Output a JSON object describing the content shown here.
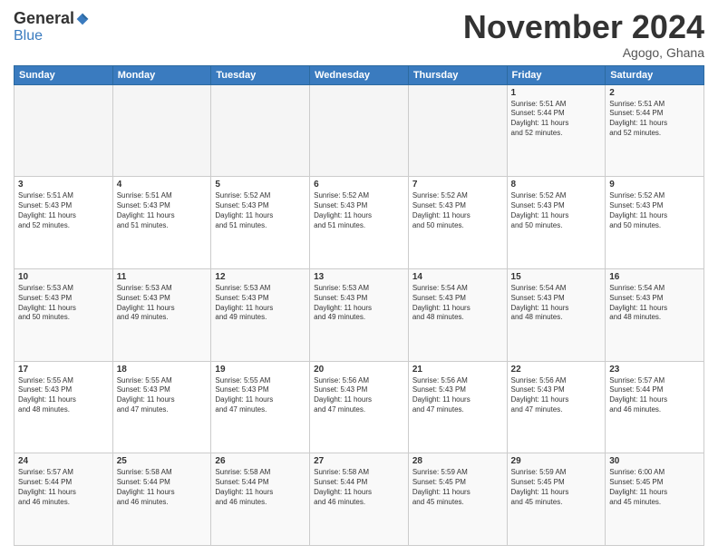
{
  "logo": {
    "general": "General",
    "blue": "Blue"
  },
  "header": {
    "month": "November 2024",
    "location": "Agogo, Ghana"
  },
  "weekdays": [
    "Sunday",
    "Monday",
    "Tuesday",
    "Wednesday",
    "Thursday",
    "Friday",
    "Saturday"
  ],
  "weeks": [
    [
      {
        "day": "",
        "content": ""
      },
      {
        "day": "",
        "content": ""
      },
      {
        "day": "",
        "content": ""
      },
      {
        "day": "",
        "content": ""
      },
      {
        "day": "",
        "content": ""
      },
      {
        "day": "1",
        "content": "Sunrise: 5:51 AM\nSunset: 5:44 PM\nDaylight: 11 hours\nand 52 minutes."
      },
      {
        "day": "2",
        "content": "Sunrise: 5:51 AM\nSunset: 5:44 PM\nDaylight: 11 hours\nand 52 minutes."
      }
    ],
    [
      {
        "day": "3",
        "content": "Sunrise: 5:51 AM\nSunset: 5:43 PM\nDaylight: 11 hours\nand 52 minutes."
      },
      {
        "day": "4",
        "content": "Sunrise: 5:51 AM\nSunset: 5:43 PM\nDaylight: 11 hours\nand 51 minutes."
      },
      {
        "day": "5",
        "content": "Sunrise: 5:52 AM\nSunset: 5:43 PM\nDaylight: 11 hours\nand 51 minutes."
      },
      {
        "day": "6",
        "content": "Sunrise: 5:52 AM\nSunset: 5:43 PM\nDaylight: 11 hours\nand 51 minutes."
      },
      {
        "day": "7",
        "content": "Sunrise: 5:52 AM\nSunset: 5:43 PM\nDaylight: 11 hours\nand 50 minutes."
      },
      {
        "day": "8",
        "content": "Sunrise: 5:52 AM\nSunset: 5:43 PM\nDaylight: 11 hours\nand 50 minutes."
      },
      {
        "day": "9",
        "content": "Sunrise: 5:52 AM\nSunset: 5:43 PM\nDaylight: 11 hours\nand 50 minutes."
      }
    ],
    [
      {
        "day": "10",
        "content": "Sunrise: 5:53 AM\nSunset: 5:43 PM\nDaylight: 11 hours\nand 50 minutes."
      },
      {
        "day": "11",
        "content": "Sunrise: 5:53 AM\nSunset: 5:43 PM\nDaylight: 11 hours\nand 49 minutes."
      },
      {
        "day": "12",
        "content": "Sunrise: 5:53 AM\nSunset: 5:43 PM\nDaylight: 11 hours\nand 49 minutes."
      },
      {
        "day": "13",
        "content": "Sunrise: 5:53 AM\nSunset: 5:43 PM\nDaylight: 11 hours\nand 49 minutes."
      },
      {
        "day": "14",
        "content": "Sunrise: 5:54 AM\nSunset: 5:43 PM\nDaylight: 11 hours\nand 48 minutes."
      },
      {
        "day": "15",
        "content": "Sunrise: 5:54 AM\nSunset: 5:43 PM\nDaylight: 11 hours\nand 48 minutes."
      },
      {
        "day": "16",
        "content": "Sunrise: 5:54 AM\nSunset: 5:43 PM\nDaylight: 11 hours\nand 48 minutes."
      }
    ],
    [
      {
        "day": "17",
        "content": "Sunrise: 5:55 AM\nSunset: 5:43 PM\nDaylight: 11 hours\nand 48 minutes."
      },
      {
        "day": "18",
        "content": "Sunrise: 5:55 AM\nSunset: 5:43 PM\nDaylight: 11 hours\nand 47 minutes."
      },
      {
        "day": "19",
        "content": "Sunrise: 5:55 AM\nSunset: 5:43 PM\nDaylight: 11 hours\nand 47 minutes."
      },
      {
        "day": "20",
        "content": "Sunrise: 5:56 AM\nSunset: 5:43 PM\nDaylight: 11 hours\nand 47 minutes."
      },
      {
        "day": "21",
        "content": "Sunrise: 5:56 AM\nSunset: 5:43 PM\nDaylight: 11 hours\nand 47 minutes."
      },
      {
        "day": "22",
        "content": "Sunrise: 5:56 AM\nSunset: 5:43 PM\nDaylight: 11 hours\nand 47 minutes."
      },
      {
        "day": "23",
        "content": "Sunrise: 5:57 AM\nSunset: 5:44 PM\nDaylight: 11 hours\nand 46 minutes."
      }
    ],
    [
      {
        "day": "24",
        "content": "Sunrise: 5:57 AM\nSunset: 5:44 PM\nDaylight: 11 hours\nand 46 minutes."
      },
      {
        "day": "25",
        "content": "Sunrise: 5:58 AM\nSunset: 5:44 PM\nDaylight: 11 hours\nand 46 minutes."
      },
      {
        "day": "26",
        "content": "Sunrise: 5:58 AM\nSunset: 5:44 PM\nDaylight: 11 hours\nand 46 minutes."
      },
      {
        "day": "27",
        "content": "Sunrise: 5:58 AM\nSunset: 5:44 PM\nDaylight: 11 hours\nand 46 minutes."
      },
      {
        "day": "28",
        "content": "Sunrise: 5:59 AM\nSunset: 5:45 PM\nDaylight: 11 hours\nand 45 minutes."
      },
      {
        "day": "29",
        "content": "Sunrise: 5:59 AM\nSunset: 5:45 PM\nDaylight: 11 hours\nand 45 minutes."
      },
      {
        "day": "30",
        "content": "Sunrise: 6:00 AM\nSunset: 5:45 PM\nDaylight: 11 hours\nand 45 minutes."
      }
    ]
  ]
}
